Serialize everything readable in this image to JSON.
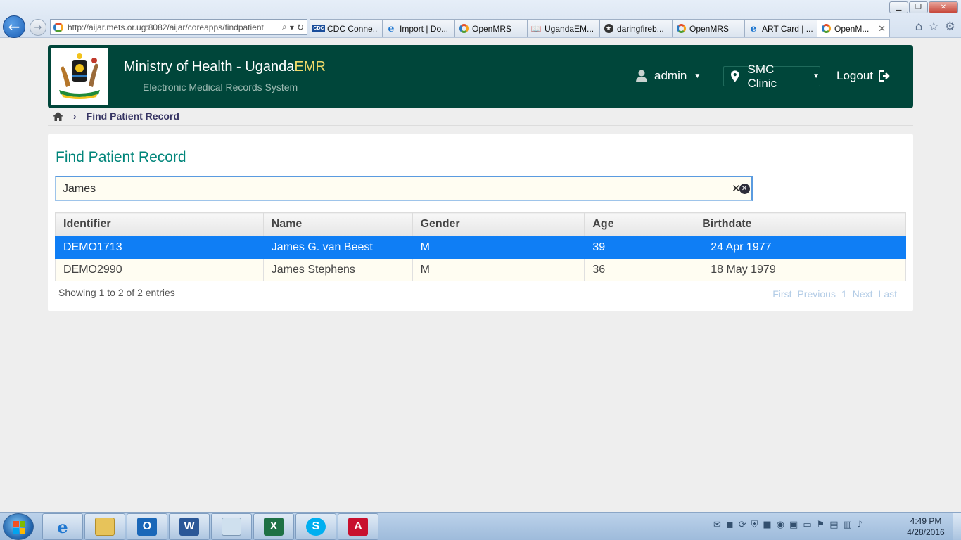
{
  "browser": {
    "url": "http://aijar.mets.or.ug:8082/aijar/coreapps/findpatient",
    "tabs": [
      {
        "label": "CDC Conne...",
        "icon": "cdc-icon",
        "active": false
      },
      {
        "label": "Import | Do...",
        "icon": "ie-icon",
        "active": false
      },
      {
        "label": "OpenMRS",
        "icon": "openmrs-icon",
        "active": false
      },
      {
        "label": "UgandaEM...",
        "icon": "book-icon",
        "active": false
      },
      {
        "label": "daringfireb...",
        "icon": "star-icon",
        "active": false
      },
      {
        "label": "OpenMRS",
        "icon": "openmrs-icon",
        "active": false
      },
      {
        "label": "ART Card | ...",
        "icon": "ie-icon",
        "active": false
      },
      {
        "label": "OpenM...",
        "icon": "openmrs-icon",
        "active": true
      }
    ]
  },
  "header": {
    "title_prefix": "Ministry of Health - Uganda",
    "title_suffix": "EMR",
    "subtitle": "Electronic Medical Records System",
    "user": "admin",
    "location": "SMC Clinic",
    "logout": "Logout"
  },
  "breadcrumb": {
    "current": "Find Patient Record"
  },
  "main": {
    "title": "Find Patient Record",
    "search_value": "James",
    "table": {
      "columns": [
        "Identifier",
        "Name",
        "Gender",
        "Age",
        "Birthdate"
      ],
      "rows": [
        {
          "identifier": "DEMO1713",
          "name": "James G. van Beest",
          "gender": "M",
          "age": "39",
          "birthdate": "24 Apr 1977",
          "selected": true
        },
        {
          "identifier": "DEMO2990",
          "name": "James Stephens",
          "gender": "M",
          "age": "36",
          "birthdate": "18 May 1979",
          "selected": false
        }
      ]
    },
    "showing": "Showing 1 to 2 of 2 entries",
    "pager": {
      "first": "First",
      "previous": "Previous",
      "page": "1",
      "next": "Next",
      "last": "Last"
    }
  },
  "taskbar": {
    "time": "4:49 PM",
    "date": "4/28/2016"
  },
  "colors": {
    "header_bg": "#00463a",
    "title_accent": "#00857a",
    "selected_row": "#0f7ef5",
    "emr_yellow": "#f0db6a"
  }
}
